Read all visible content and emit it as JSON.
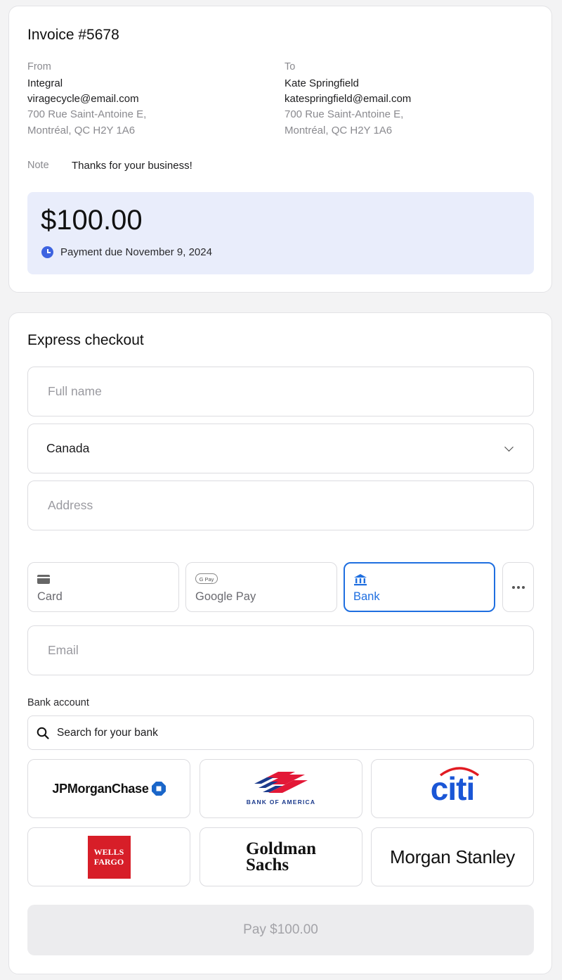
{
  "invoice": {
    "title": "Invoice #5678",
    "from": {
      "label": "From",
      "name": "Integral",
      "email": "viragecycle@email.com",
      "address_line1": "700 Rue Saint-Antoine E,",
      "address_line2": "Montréal, QC  H2Y 1A6"
    },
    "to": {
      "label": "To",
      "name": "Kate Springfield",
      "email": "katespringfield@email.com",
      "address_line1": "700 Rue Saint-Antoine E,",
      "address_line2": "Montréal, QC  H2Y 1A6"
    },
    "note_label": "Note",
    "note_text": "Thanks for your business!",
    "amount": "$100.00",
    "due_text": "Payment due November 9, 2024"
  },
  "checkout": {
    "title": "Express checkout",
    "full_name_placeholder": "Full name",
    "country_value": "Canada",
    "address_placeholder": "Address",
    "payment_methods": [
      {
        "label": "Card",
        "icon": "credit-card-icon"
      },
      {
        "label": "Google Pay",
        "icon": "google-pay-icon",
        "icon_text": "G Pay"
      },
      {
        "label": "Bank",
        "icon": "bank-icon"
      }
    ],
    "more_icon": "more-dots-icon",
    "email_placeholder": "Email",
    "bank_account_label": "Bank account",
    "bank_search_placeholder": "Search for your bank",
    "banks": {
      "chase": "JPMorganChase",
      "boa": "BANK OF AMERICA",
      "citi": "citi",
      "wells_line1": "WELLS",
      "wells_line2": "FARGO",
      "goldman_line1": "Goldman",
      "goldman_line2": "Sachs",
      "morgan_stanley": "Morgan Stanley"
    },
    "pay_button": "Pay $100.00"
  },
  "colors": {
    "accent": "#1f6fe0",
    "amount_bg": "#e9edfb",
    "citi_blue": "#1a56d6",
    "citi_red": "#e11b22",
    "wells_red": "#d71e28",
    "boa_red": "#e31837",
    "boa_blue": "#1b3a8c"
  }
}
